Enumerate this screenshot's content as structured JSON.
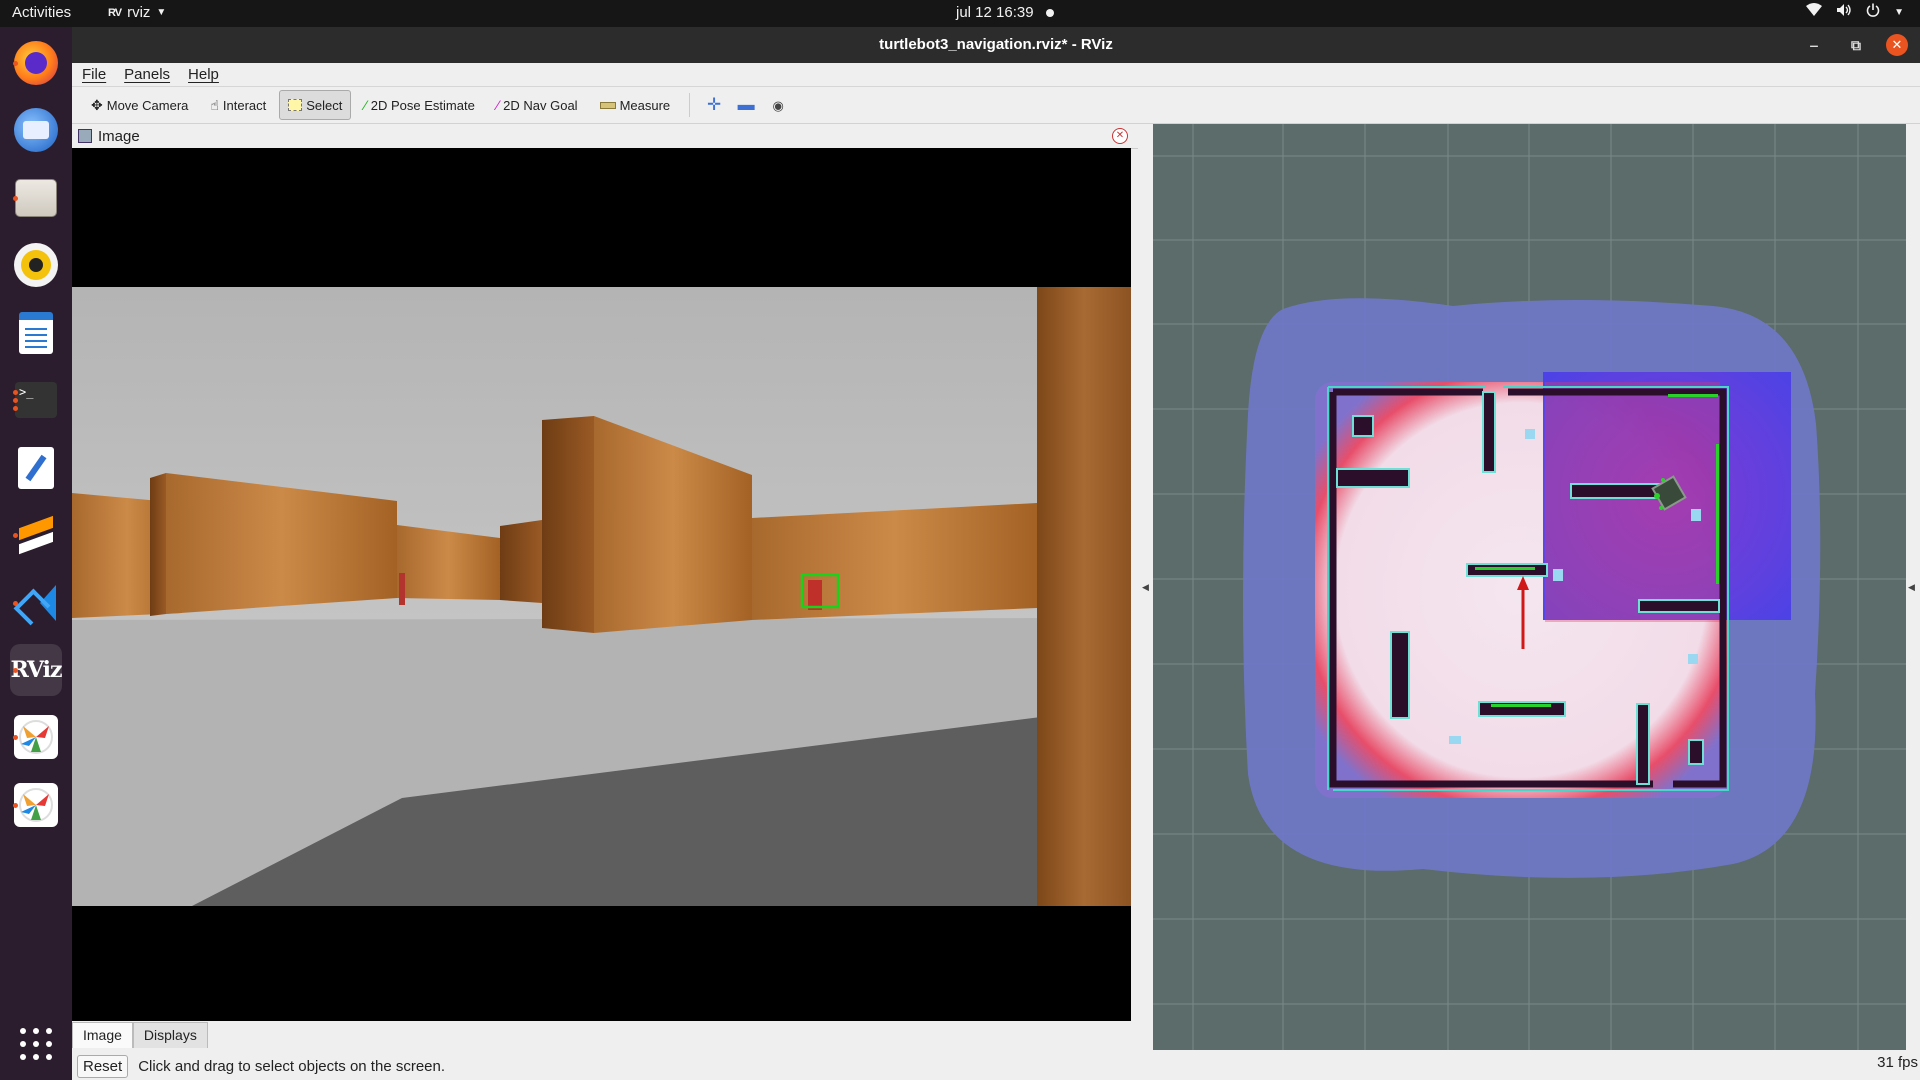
{
  "topbar": {
    "activities": "Activities",
    "app_name": "rviz",
    "datetime": "jul 12  16:39"
  },
  "dock": {
    "items": [
      {
        "name": "firefox",
        "icon": "firefox-icon",
        "color": "#e66000"
      },
      {
        "name": "thunderbird",
        "icon": "thunderbird-icon",
        "color": "#2a6fd6"
      },
      {
        "name": "files",
        "icon": "files-icon",
        "color": "#cfcbc4"
      },
      {
        "name": "rhythmbox",
        "icon": "rhythmbox-icon",
        "color": "#f4c20d"
      },
      {
        "name": "libreoffice-writer",
        "icon": "writer-icon",
        "color": "#2a7ad1"
      },
      {
        "name": "terminal",
        "icon": "terminal-icon",
        "color": "#333333"
      },
      {
        "name": "text-editor",
        "icon": "text-editor-icon",
        "color": "#ffffff"
      },
      {
        "name": "sublime-text",
        "icon": "sublime-icon",
        "color": "#ff9800"
      },
      {
        "name": "vscode",
        "icon": "vscode-icon",
        "color": "#1e88e5"
      },
      {
        "name": "rviz",
        "icon": "rviz-icon",
        "label": "RViz"
      },
      {
        "name": "gazebo-1",
        "icon": "gazebo-icon",
        "color": "#f0a030"
      },
      {
        "name": "gazebo-2",
        "icon": "gazebo-icon",
        "color": "#f0a030"
      }
    ]
  },
  "window": {
    "title": "turtlebot3_navigation.rviz* - RViz"
  },
  "menubar": {
    "items": [
      "File",
      "Panels",
      "Help"
    ]
  },
  "toolbar": {
    "tools": [
      "Move Camera",
      "Interact",
      "Select",
      "2D Pose Estimate",
      "2D Nav Goal",
      "Measure"
    ],
    "selected": "Select"
  },
  "image_panel": {
    "title": "Image"
  },
  "bottom_tabs": [
    "Image",
    "Displays"
  ],
  "active_tab": "Image",
  "statusbar": {
    "reset_label": "Reset",
    "hint": "Click and drag to select objects on the screen.",
    "fps": "31 fps"
  },
  "colors": {
    "topbar": "#161616",
    "dock": "#2b1d2d",
    "accent": "#e95420",
    "map_bg": "#5c6c6a",
    "costmap_inflation": "#7a7ed0",
    "local_costmap": "#5a3fd0",
    "path_arrow": "#d01818"
  }
}
